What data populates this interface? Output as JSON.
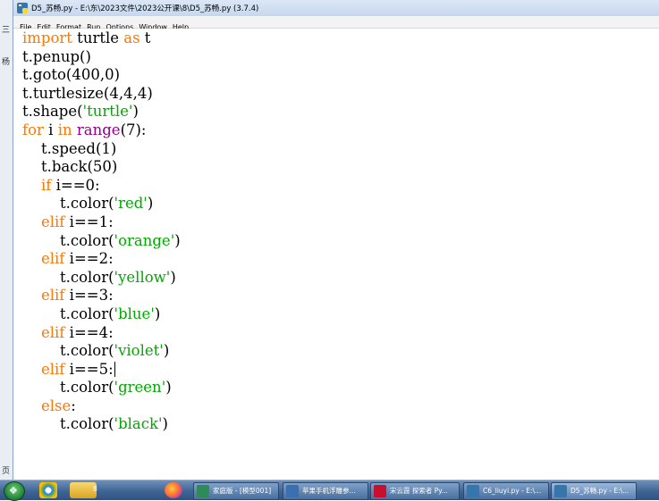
{
  "window": {
    "title": "D5_苏畅.py - E:\\东\\2023文件\\2023公开课\\8\\D5_苏畅.py (3.7.4)"
  },
  "menu": [
    "File",
    "Edit",
    "Format",
    "Run",
    "Options",
    "Window",
    "Help"
  ],
  "left_fragments": [
    "三",
    "杨",
    "页"
  ],
  "code_lines": [
    [
      {
        "t": "import",
        "c": "kw"
      },
      {
        "t": " turtle ",
        "c": ""
      },
      {
        "t": "as",
        "c": "kw"
      },
      {
        "t": " t",
        "c": ""
      }
    ],
    [
      {
        "t": "t.penup()",
        "c": ""
      }
    ],
    [
      {
        "t": "t.goto(400,0)",
        "c": ""
      }
    ],
    [
      {
        "t": "t.turtlesize(4,4,4)",
        "c": ""
      }
    ],
    [
      {
        "t": "t.shape(",
        "c": ""
      },
      {
        "t": "'turtle'",
        "c": "str"
      },
      {
        "t": ")",
        "c": ""
      }
    ],
    [
      {
        "t": "for",
        "c": "kw"
      },
      {
        "t": " i ",
        "c": ""
      },
      {
        "t": "in",
        "c": "kw"
      },
      {
        "t": " ",
        "c": ""
      },
      {
        "t": "range",
        "c": "bi"
      },
      {
        "t": "(7):",
        "c": ""
      }
    ],
    [
      {
        "t": "    t.speed(1)",
        "c": ""
      }
    ],
    [
      {
        "t": "    t.back(50)",
        "c": ""
      }
    ],
    [
      {
        "t": "    ",
        "c": ""
      },
      {
        "t": "if",
        "c": "kw"
      },
      {
        "t": " i==0:",
        "c": ""
      }
    ],
    [
      {
        "t": "        t.color(",
        "c": ""
      },
      {
        "t": "'red'",
        "c": "str"
      },
      {
        "t": ")",
        "c": ""
      }
    ],
    [
      {
        "t": "    ",
        "c": ""
      },
      {
        "t": "elif",
        "c": "kw"
      },
      {
        "t": " i==1:",
        "c": ""
      }
    ],
    [
      {
        "t": "        t.color(",
        "c": ""
      },
      {
        "t": "'orange'",
        "c": "str"
      },
      {
        "t": ")",
        "c": ""
      }
    ],
    [
      {
        "t": "    ",
        "c": ""
      },
      {
        "t": "elif",
        "c": "kw"
      },
      {
        "t": " i==2:",
        "c": ""
      }
    ],
    [
      {
        "t": "        t.color(",
        "c": ""
      },
      {
        "t": "'yellow'",
        "c": "str"
      },
      {
        "t": ")",
        "c": ""
      }
    ],
    [
      {
        "t": "    ",
        "c": ""
      },
      {
        "t": "elif",
        "c": "kw"
      },
      {
        "t": " i==3:",
        "c": ""
      }
    ],
    [
      {
        "t": "        t.color(",
        "c": ""
      },
      {
        "t": "'blue'",
        "c": "str"
      },
      {
        "t": ")",
        "c": ""
      }
    ],
    [
      {
        "t": "    ",
        "c": ""
      },
      {
        "t": "elif",
        "c": "kw"
      },
      {
        "t": " i==4:",
        "c": ""
      }
    ],
    [
      {
        "t": "        t.color(",
        "c": ""
      },
      {
        "t": "'violet'",
        "c": "str"
      },
      {
        "t": ")",
        "c": ""
      }
    ],
    [
      {
        "t": "    ",
        "c": ""
      },
      {
        "t": "elif",
        "c": "kw"
      },
      {
        "t": " i==5:",
        "c": ""
      }
    ],
    [
      {
        "t": "        t.color(",
        "c": ""
      },
      {
        "t": "'green'",
        "c": "str"
      },
      {
        "t": ")",
        "c": ""
      }
    ],
    [
      {
        "t": "    ",
        "c": ""
      },
      {
        "t": "else",
        "c": "kw"
      },
      {
        "t": ":",
        "c": ""
      }
    ],
    [
      {
        "t": "        t.color(",
        "c": ""
      },
      {
        "t": "'black'",
        "c": "str"
      },
      {
        "t": ")",
        "c": ""
      }
    ]
  ],
  "cursor_line": 18,
  "colors": {
    "keyword": "#ff7700",
    "builtin": "#900090",
    "string": "#00aa00"
  },
  "taskbar": {
    "start_icon": "windows-orb-icon",
    "quick_launch": [
      {
        "icon": "chrome-icon"
      },
      {
        "icon": "folder-icon"
      },
      {
        "icon": "firefox-icon"
      }
    ],
    "folder_badge": "8",
    "tasks": [
      {
        "icon": "send-icon",
        "label": "家庭版 - [模型001]",
        "color": "#2e8b57"
      },
      {
        "icon": "photo-icon",
        "label": "苹果手机浮雕参...",
        "color": "#3b6fb0"
      },
      {
        "icon": "wps-icon",
        "label": "宋云霞 探索者 Py...",
        "color": "#c8102e"
      },
      {
        "icon": "python-icon",
        "label": "C6_liuyi.py - E:\\...",
        "color": "#3776ab"
      },
      {
        "icon": "python-icon",
        "label": "D5_苏畅.py - E:\\...",
        "color": "#3776ab",
        "active": true
      }
    ]
  }
}
